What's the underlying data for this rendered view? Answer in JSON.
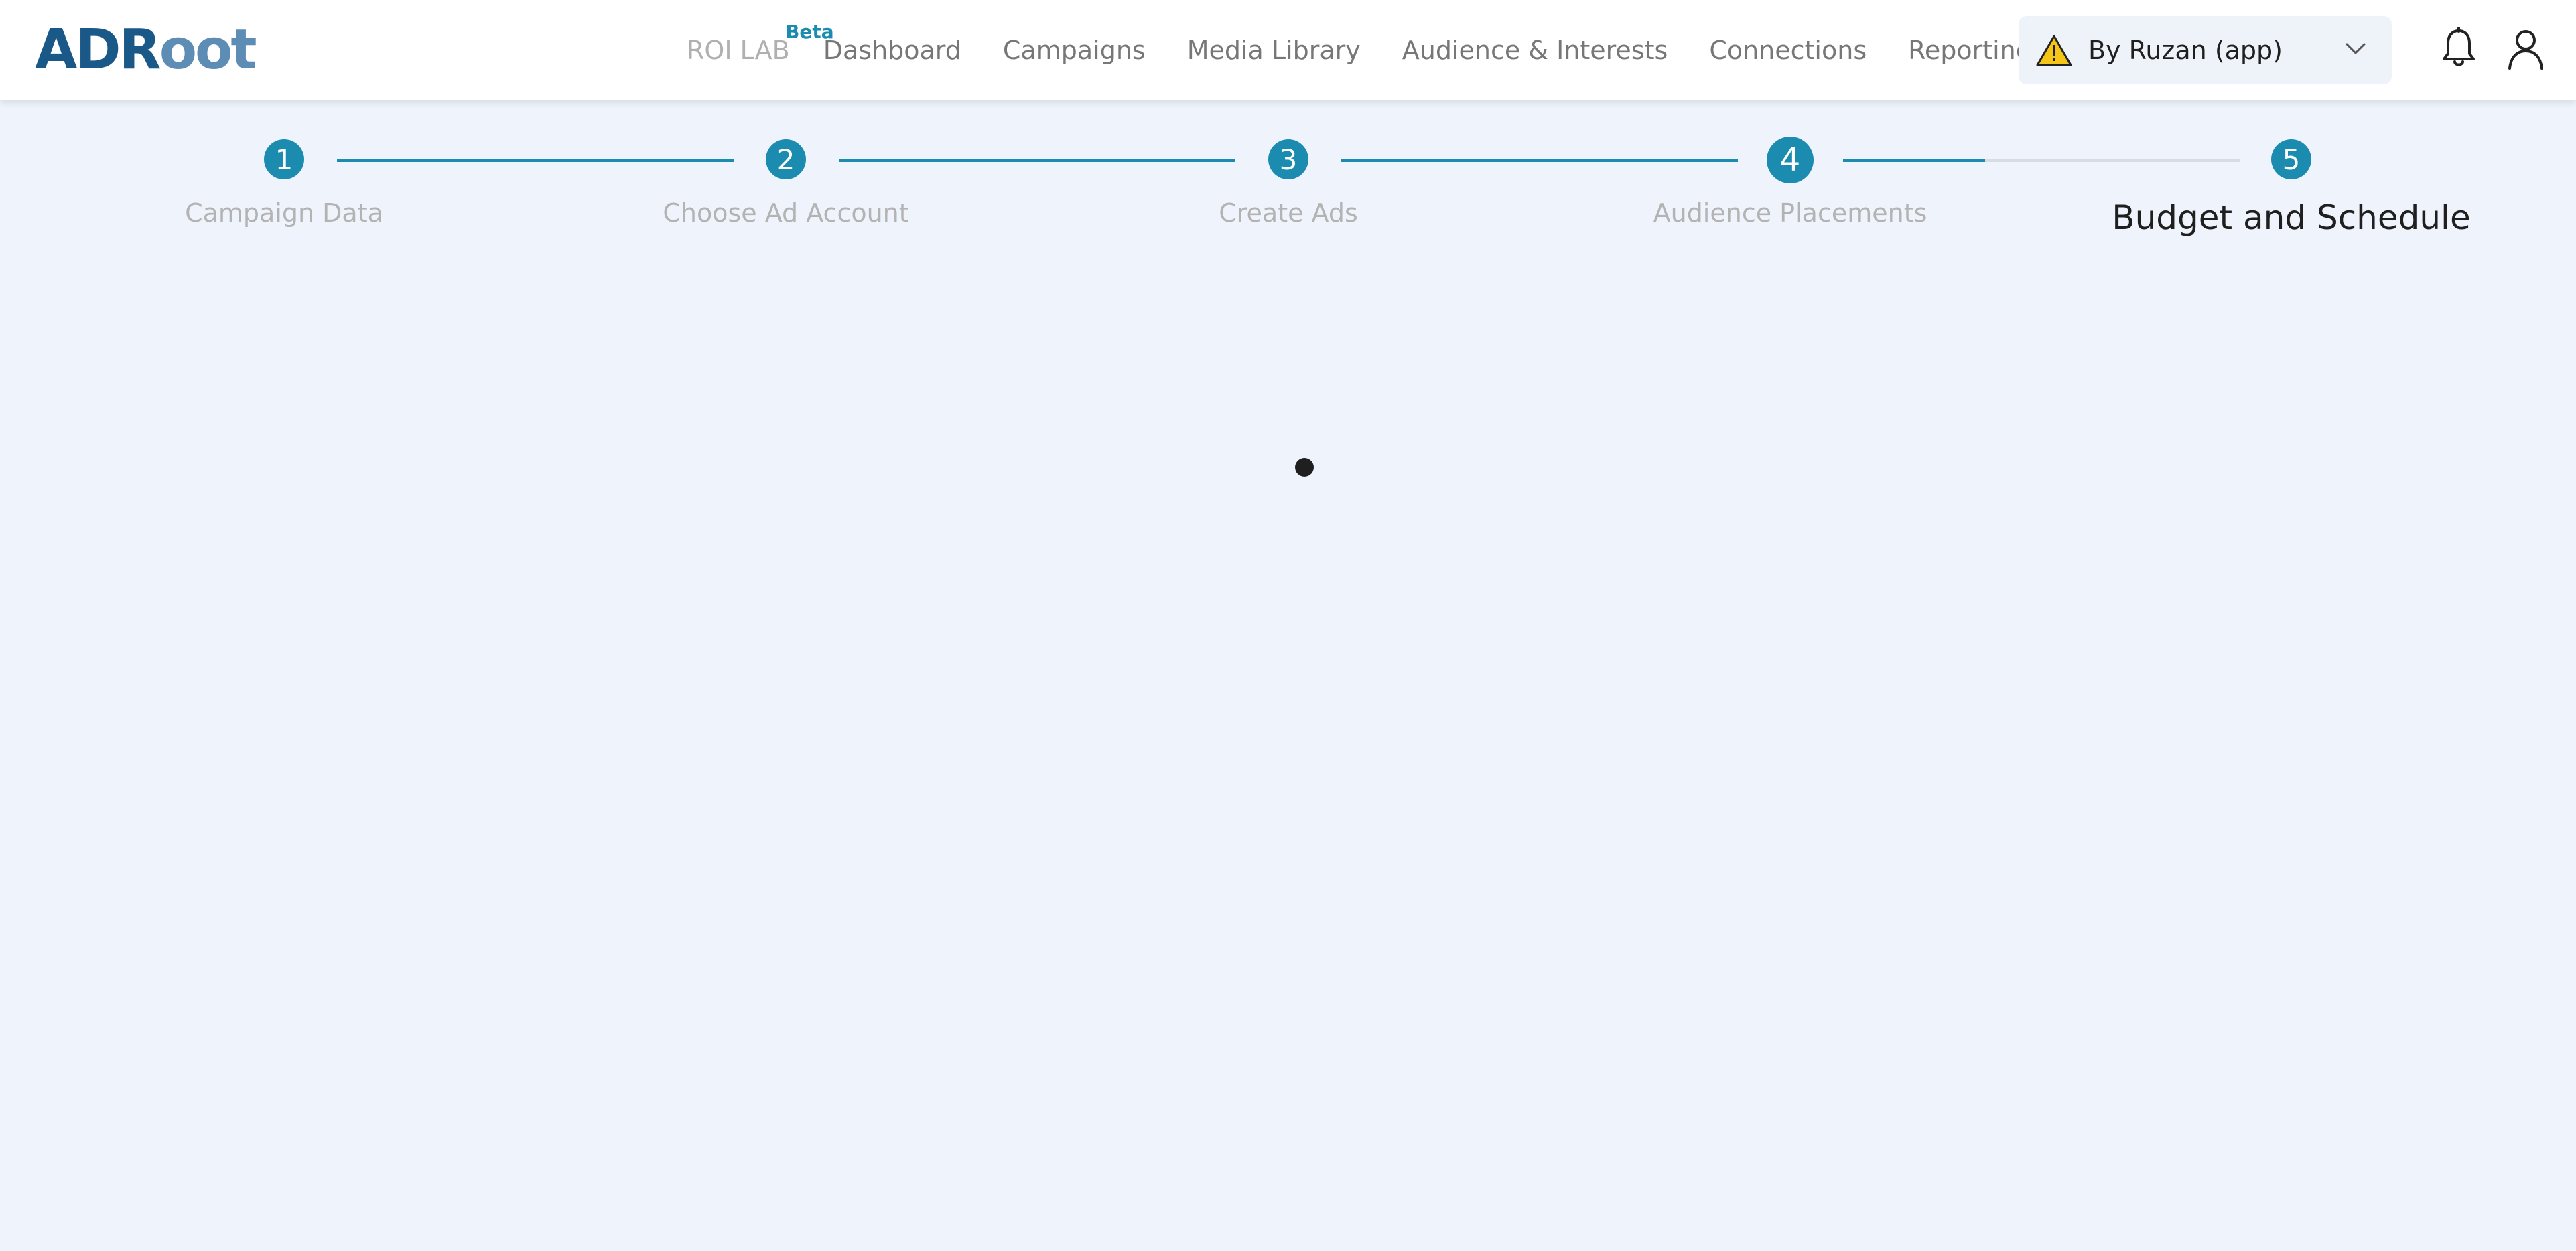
{
  "header": {
    "logo": {
      "part1": "A",
      "part2": "D",
      "part3": "R",
      "part4": "oot"
    },
    "nav": {
      "roi_lab": "ROI LAB",
      "beta": "Beta",
      "items": [
        "Dashboard",
        "Campaigns",
        "Media Library",
        "Audience & Interests",
        "Connections",
        "Reporting"
      ]
    },
    "account": {
      "label": "By Ruzan (app)",
      "status_icon": "warning-icon"
    },
    "icons": [
      "bell-icon",
      "user-icon"
    ]
  },
  "stepper": {
    "steps": [
      {
        "number": "1",
        "label": "Campaign Data"
      },
      {
        "number": "2",
        "label": "Choose Ad Account"
      },
      {
        "number": "3",
        "label": "Create Ads"
      },
      {
        "number": "4",
        "label": "Audience Placements"
      },
      {
        "number": "5",
        "label": "Budget and Schedule"
      }
    ],
    "active_step": 5
  },
  "colors": {
    "accent": "#1b8bb0",
    "background": "#eff4fc",
    "logo_dark": "#1a5888",
    "logo_light": "#5d8db5",
    "warning": "#f5c518"
  }
}
